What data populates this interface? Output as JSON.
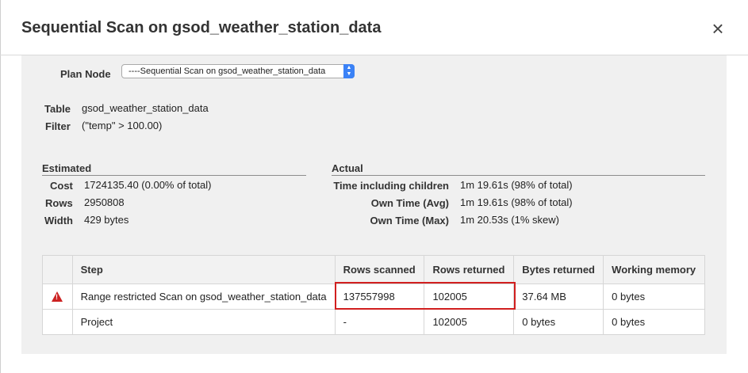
{
  "dialog": {
    "title": "Sequential Scan on gsod_weather_station_data",
    "close_glyph": "×"
  },
  "plan_node": {
    "label": "Plan Node",
    "selected": "----Sequential Scan on gsod_weather_station_data"
  },
  "details": {
    "table_label": "Table",
    "table_value": "gsod_weather_station_data",
    "filter_label": "Filter",
    "filter_value": "(\"temp\" > 100.00)"
  },
  "estimated": {
    "title": "Estimated",
    "cost_label": "Cost",
    "cost_value": "1724135.40 (0.00% of total)",
    "rows_label": "Rows",
    "rows_value": "2950808",
    "width_label": "Width",
    "width_value": "429 bytes"
  },
  "actual": {
    "title": "Actual",
    "time_children_label": "Time including children",
    "time_children_value": "1m 19.61s  (98% of total)",
    "own_avg_label": "Own Time (Avg)",
    "own_avg_value": "1m 19.61s  (98% of total)",
    "own_max_label": "Own Time (Max)",
    "own_max_value": "1m 20.53s  (1% skew)"
  },
  "steps_table": {
    "headers": [
      "",
      "Step",
      "Rows scanned",
      "Rows returned",
      "Bytes returned",
      "Working memory"
    ],
    "rows": [
      {
        "warning": true,
        "step": "Range restricted Scan on gsod_weather_station_data",
        "rows_scanned": "137557998",
        "rows_returned": "102005",
        "bytes_returned": "37.64 MB",
        "working_memory": "0 bytes"
      },
      {
        "warning": false,
        "step": "Project",
        "rows_scanned": "-",
        "rows_returned": "102005",
        "bytes_returned": "0 bytes",
        "working_memory": "0 bytes"
      }
    ]
  },
  "colors": {
    "highlight": "#d11f1f",
    "warning": "#cc2222",
    "select_accent": "#3b82f6"
  }
}
